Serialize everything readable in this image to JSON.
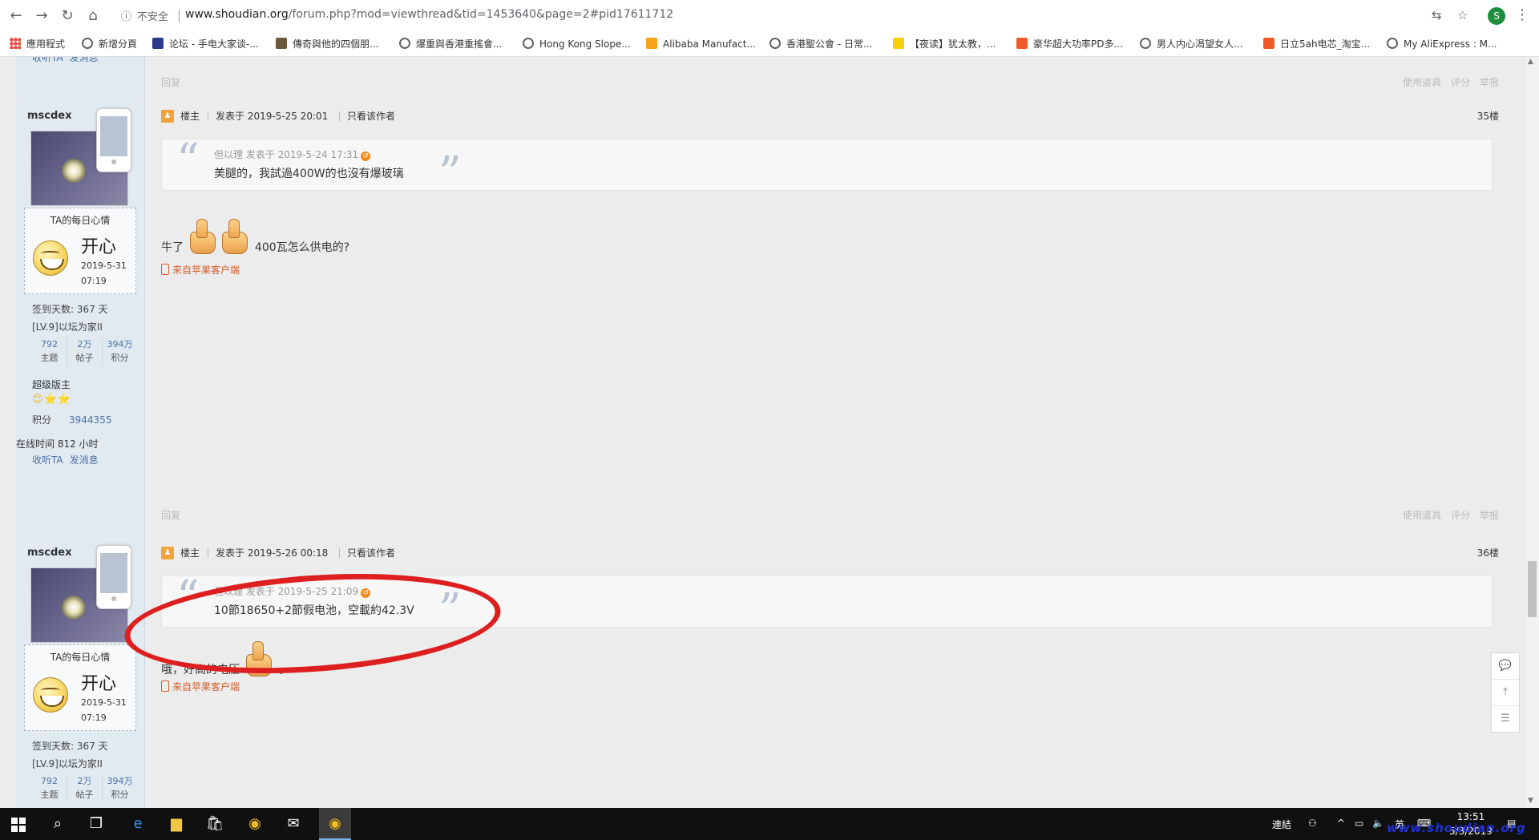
{
  "browser": {
    "insecure_label": "不安全",
    "url_domain": "www.shoudian.org",
    "url_rest": "/forum.php?mod=viewthread&tid=1453640&page=2#pid17611712",
    "profile_initial": "S"
  },
  "bookmarks": [
    {
      "label": "應用程式",
      "icon": "apps-icon"
    },
    {
      "label": "新增分頁",
      "icon": "globe-icon"
    },
    {
      "label": "论坛 - 手电大家谈-...",
      "icon": "forum-favicon"
    },
    {
      "label": "傳奇與他的四個朋...",
      "icon": "book-favicon"
    },
    {
      "label": "爆重與香港重搖會...",
      "icon": "globe-icon"
    },
    {
      "label": "Hong Kong Slope...",
      "icon": "globe-icon"
    },
    {
      "label": "Alibaba Manufact...",
      "icon": "alibaba-favicon"
    },
    {
      "label": "香港聖公會 - 日常...",
      "icon": "globe-icon"
    },
    {
      "label": "【夜读】犹太教，...",
      "icon": "s-favicon"
    },
    {
      "label": "豪华超大功率PD多...",
      "icon": "taobao-favicon"
    },
    {
      "label": "男人内心渴望女人...",
      "icon": "globe-icon"
    },
    {
      "label": "日立5ah电芯_淘宝...",
      "icon": "taobao-favicon"
    },
    {
      "label": "My AliExpress : M...",
      "icon": "globe-icon"
    }
  ],
  "reply_bar": {
    "reply_label": "回复",
    "tools_label": "使用道具",
    "rate_label": "评分",
    "report_label": "举报"
  },
  "author": {
    "name": "mscdex",
    "mood_title": "TA的每日心情",
    "mood": "开心",
    "mood_date": "2019-5-31",
    "mood_time": "07:19",
    "checkin": "签到天数: 367 天",
    "level": "[LV.9]以坛为家II",
    "stats": [
      {
        "value": "792",
        "label": "主题"
      },
      {
        "value": "2万",
        "label": "帖子"
      },
      {
        "value": "394万",
        "label": "积分"
      }
    ],
    "role": "超级版主",
    "stars": "😊⭐⭐",
    "credit_label": "积分",
    "credit_value": "3944355",
    "online": "在线时间 812 小时",
    "follow": "收听TA",
    "message": "发消息"
  },
  "posts": [
    {
      "op_label": "楼主",
      "posted": "发表于 2019-5-25 20:01",
      "only_author": "只看该作者",
      "floor": "35楼",
      "quote_meta": "但以理 发表于 2019-5-24 17:31",
      "quote_text": "美腿的，我試過400W的也沒有爆玻璃",
      "body_before": "牛了",
      "body_after": "400瓦怎么供电的?",
      "client": "来自苹果客户端"
    },
    {
      "op_label": "楼主",
      "posted": "发表于 2019-5-26 00:18",
      "only_author": "只看该作者",
      "floor": "36楼",
      "quote_meta": "但以理 发表于 2019-5-25 21:09",
      "quote_text": "10節18650+2節假电池，空載約42.3V",
      "body_before": "哦，好高的电压",
      "body_after": "。",
      "client": "来自苹果客户端"
    }
  ],
  "taskbar": {
    "lang_label": "連結",
    "ime": "英",
    "time": "13:51",
    "date": "5/3/2019"
  },
  "watermark": "www.shoudian.org"
}
